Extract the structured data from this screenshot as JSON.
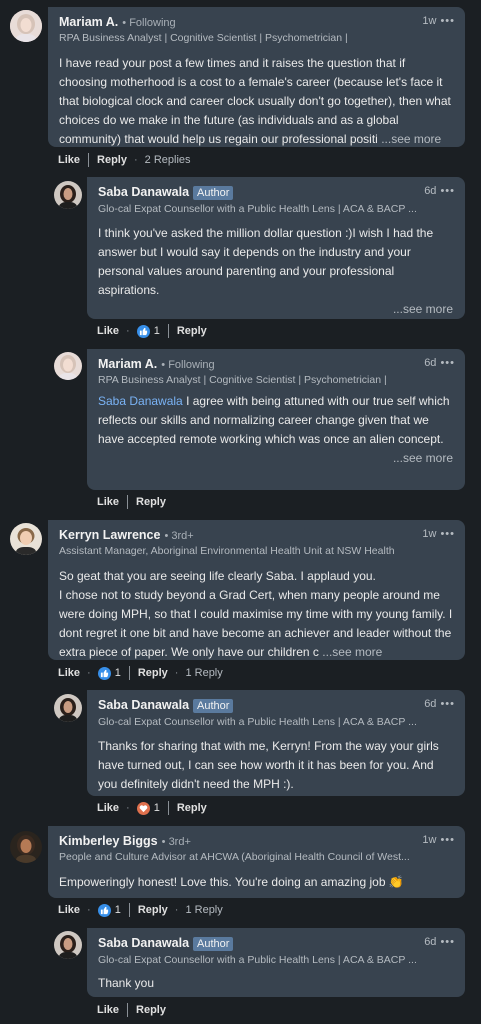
{
  "labels": {
    "like": "Like",
    "reply": "Reply",
    "following": "Following",
    "author": "Author",
    "see_more": "...see more",
    "dots": "•••",
    "bullet": "•",
    "mid_dot": "·"
  },
  "comments": [
    {
      "name": "Mariam A.",
      "meta": "Following",
      "headline": "RPA Business Analyst | Cognitive Scientist | Psychometrician |",
      "time": "1w",
      "text": "I have read your post a few times and it raises the question that if choosing motherhood is a cost to a female's career (because let's face it that biological clock and career clock usually don't go together), then what choices do we make in the future (as individuals and as a global community) that would help us regain our professional positi",
      "see_more": "...see more",
      "replies": "2 Replies"
    },
    {
      "name": "Saba Danawala",
      "badge": "Author",
      "headline": "Glo-cal Expat Counsellor with a Public Health Lens | ACA & BACP ...",
      "time": "6d",
      "text": "I think you've asked the million dollar question :)I wish I had the answer but I would say it depends on the industry and your personal values around parenting and your professional aspirations.",
      "see_more": "...see more",
      "reaction_count": "1",
      "reaction_icon": "thumbs-up-icon"
    },
    {
      "name": "Mariam A.",
      "meta": "Following",
      "headline": "RPA Business Analyst | Cognitive Scientist | Psychometrician |",
      "time": "6d",
      "mention": "Saba Danawala",
      "text": " I agree with being attuned with our true self which reflects our skills and normalizing career change given that we have accepted remote working which was once an alien concept.",
      "see_more": "...see more"
    },
    {
      "name": "Kerryn Lawrence",
      "meta": "3rd+",
      "headline": "Assistant Manager, Aboriginal Environmental Health Unit at NSW Health",
      "time": "1w",
      "text": "So geat that you are seeing life clearly Saba. I applaud you.\nI chose not to study beyond a Grad Cert, when many people around me were doing MPH, so that I could maximise my time with my young family. I dont regret it one bit and have become an achiever and leader without the extra piece of paper. We only have our children c",
      "see_more": "...see more",
      "reaction_count": "1",
      "reaction_icon": "thumbs-up-icon",
      "replies": "1 Reply"
    },
    {
      "name": "Saba Danawala",
      "badge": "Author",
      "headline": "Glo-cal Expat Counsellor with a Public Health Lens | ACA & BACP ...",
      "time": "6d",
      "text": "Thanks for sharing that with me, Kerryn! From the way your girls have turned out, I can see how worth it it has been for you. And you definitely didn't need the MPH :).",
      "reaction_count": "1",
      "reaction_icon": "heart-icon"
    },
    {
      "name": "Kimberley Biggs",
      "meta": "3rd+",
      "headline": "People and Culture Advisor at AHCWA (Aboriginal Health Council of West...",
      "time": "1w",
      "text": "Empoweringly honest! Love this. You're doing an amazing job 👏",
      "reaction_count": "1",
      "reaction_icon": "thumbs-up-icon",
      "replies": "1 Reply"
    },
    {
      "name": "Saba Danawala",
      "badge": "Author",
      "headline": "Glo-cal Expat Counsellor with a Public Health Lens | ACA & BACP ...",
      "time": "6d",
      "text": "Thank you"
    }
  ],
  "colors": {
    "background": "#1b1f23",
    "bubble": "#38434f",
    "mention": "#7ab3f5",
    "like_reaction": "#378fe9",
    "love_reaction": "#df704d",
    "author_badge": "#5a7a9e"
  }
}
